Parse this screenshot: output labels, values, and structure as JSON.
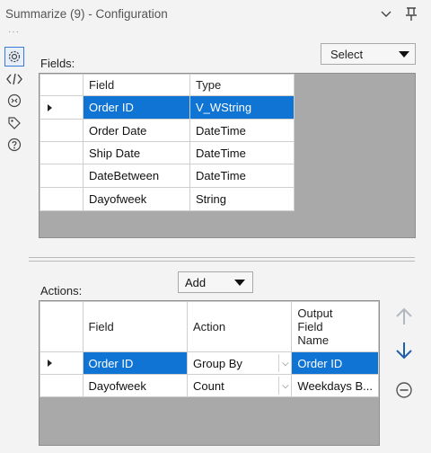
{
  "window": {
    "title": "Summarize (9) - Configuration"
  },
  "titlebar": {
    "menu_icon": "chevron-down-icon",
    "pin_icon": "pin-icon"
  },
  "leftbar": {
    "icons": [
      "gear-icon",
      "code-icon",
      "connection-icon",
      "tag-icon",
      "help-icon"
    ],
    "active": "gear-icon"
  },
  "fields": {
    "label": "Fields:",
    "select_label": "Select",
    "columns": [
      "Field",
      "Type"
    ],
    "rows": [
      {
        "field": "Order ID",
        "type": "V_WString",
        "selected": true
      },
      {
        "field": "Order Date",
        "type": "DateTime"
      },
      {
        "field": "Ship Date",
        "type": "DateTime"
      },
      {
        "field": "DateBetween",
        "type": "DateTime"
      },
      {
        "field": "Dayofweek",
        "type": "String"
      }
    ]
  },
  "actions": {
    "label": "Actions:",
    "add_label": "Add",
    "columns": [
      "Field",
      "Action",
      "Output\nField\nName"
    ],
    "rows": [
      {
        "field": "Order ID",
        "action": "Group By",
        "output": "Order ID",
        "selected": true
      },
      {
        "field": "Dayofweek",
        "action": "Count",
        "output": "Weekdays B..."
      }
    ],
    "buttons": [
      "move-up-icon",
      "move-down-icon",
      "remove-icon"
    ]
  },
  "colors": {
    "selection": "#0f74d4",
    "grid_empty": "#a9a9a9",
    "accent": "#3a7bd5"
  }
}
